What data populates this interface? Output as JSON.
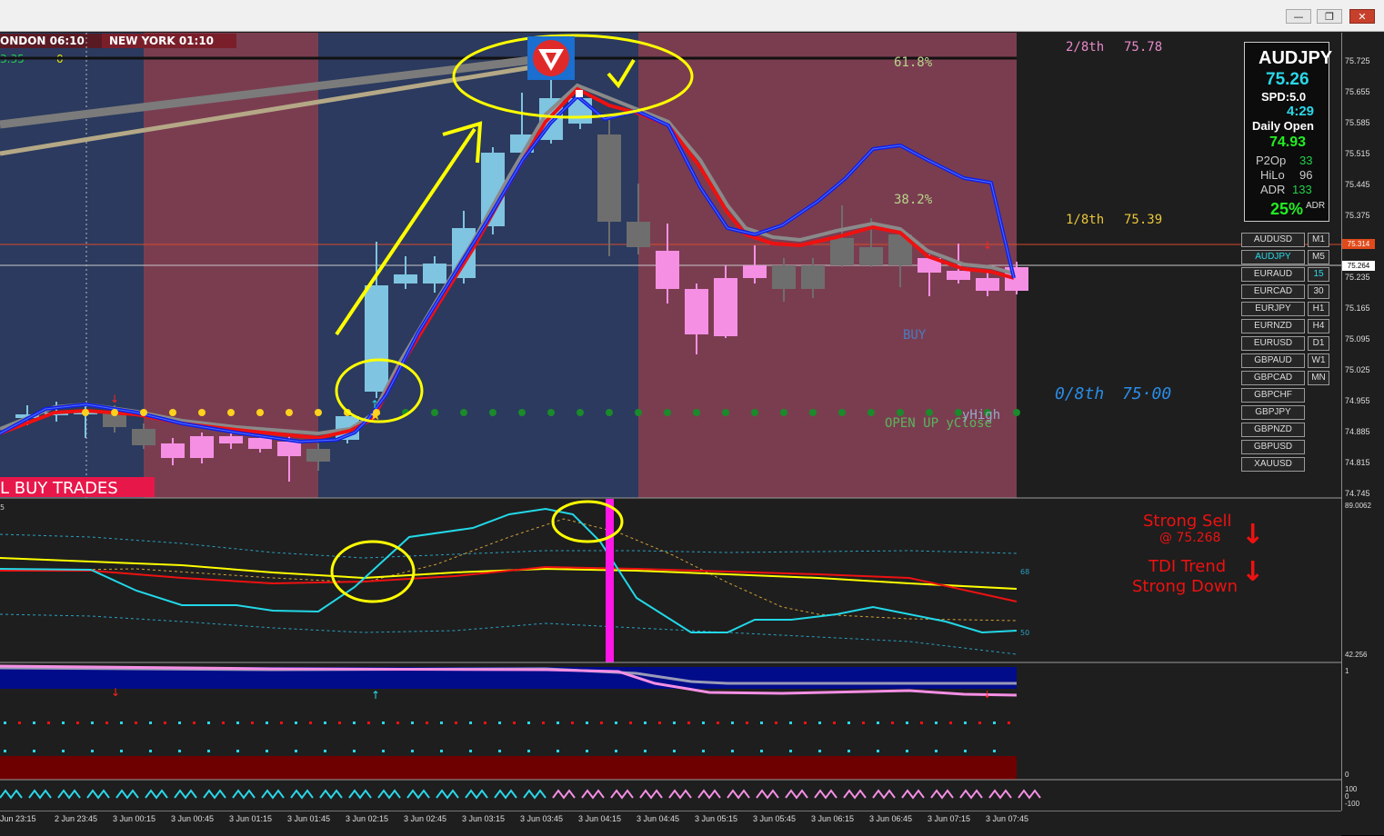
{
  "window": {
    "minimize_label": "—",
    "restore_label": "❐",
    "close_label": "✕"
  },
  "sessions": {
    "london": "ONDON  06:10",
    "newyork": "NEW YORK  01:10",
    "left_value": "3.35",
    "left_count": "0"
  },
  "banner": {
    "buy_trades": "L BUY TRADES"
  },
  "murrey": {
    "top_label": "2/8th",
    "top_value": "75.78",
    "mid_label": "1/8th",
    "mid_value": "75.39",
    "low_label": "0/8th",
    "low_value": "75·00"
  },
  "fib": {
    "f618": "61.8%",
    "f382": "38.2%"
  },
  "chart_labels": {
    "buy": "BUY",
    "open_up": "OPEN UP yClose",
    "yhigh": "yHigh"
  },
  "info_box": {
    "symbol": "AUDJPY",
    "price": "75.26",
    "spread": "SPD:5.0",
    "timer": "4:29",
    "daily_open_label": "Daily Open",
    "daily_open_value": "74.93",
    "p2op_label": "P2Op",
    "p2op_value": "33",
    "hilo_label": "HiLo",
    "hilo_value": "96",
    "adr_label": "ADR",
    "adr_value": "133",
    "adr_pct": "25%",
    "adr_small": "ADR"
  },
  "symbols": [
    {
      "name": "AUDUSD",
      "tf": "M1"
    },
    {
      "name": "AUDJPY",
      "tf": "M5",
      "active": true
    },
    {
      "name": "EURAUD",
      "tf": "15"
    },
    {
      "name": "EURCAD",
      "tf": "30"
    },
    {
      "name": "EURJPY",
      "tf": "H1"
    },
    {
      "name": "EURNZD",
      "tf": "H4"
    },
    {
      "name": "EURUSD",
      "tf": "D1"
    },
    {
      "name": "GBPAUD",
      "tf": "W1"
    },
    {
      "name": "GBPCAD",
      "tf": "MN"
    },
    {
      "name": "GBPCHF",
      "tf": ""
    },
    {
      "name": "GBPJPY",
      "tf": ""
    },
    {
      "name": "GBPNZD",
      "tf": ""
    },
    {
      "name": "GBPUSD",
      "tf": ""
    },
    {
      "name": "XAUUSD",
      "tf": ""
    }
  ],
  "price_axis": [
    "75.725",
    "75.655",
    "75.585",
    "75.515",
    "75.445",
    "75.375",
    "75.305",
    "75.235",
    "75.165",
    "75.095",
    "75.025",
    "74.955",
    "74.885",
    "74.815",
    "74.745"
  ],
  "price_markers": {
    "red_line": "75.314",
    "current": "75.264"
  },
  "tdi": {
    "strong_sell": "Strong Sell",
    "strong_sell_at": "@ 75.268",
    "trend_line1": "TDI Trend",
    "trend_line2": "Strong Down",
    "level_68": "68",
    "level_50": "50",
    "axis_top": "89.0062",
    "axis_bottom": "42.256",
    "left_tag": "5"
  },
  "lower_axis": {
    "one": "1",
    "zero": "0",
    "p100": "100",
    "zero2": "0",
    "m100": "-100"
  },
  "time_axis": [
    "Jun 23:15",
    "2 Jun 23:45",
    "3 Jun 00:15",
    "3 Jun 00:45",
    "3 Jun 01:15",
    "3 Jun 01:45",
    "3 Jun 02:15",
    "3 Jun 02:45",
    "3 Jun 03:15",
    "3 Jun 03:45",
    "3 Jun 04:15",
    "3 Jun 04:45",
    "3 Jun 05:15",
    "3 Jun 05:45",
    "3 Jun 06:15",
    "3 Jun 06:45",
    "3 Jun 07:15",
    "3 Jun 07:45"
  ],
  "colors": {
    "blue_zone": "#2b3a5e",
    "red_zone": "#7a3d50",
    "bull_candle": "#7fc4e0",
    "bear_candle": "#f58fe4",
    "grey_candle": "#6e6e6e",
    "ma_blue": "#1020e8",
    "ma_red": "#ee1111",
    "highlight": "#ffff00"
  }
}
